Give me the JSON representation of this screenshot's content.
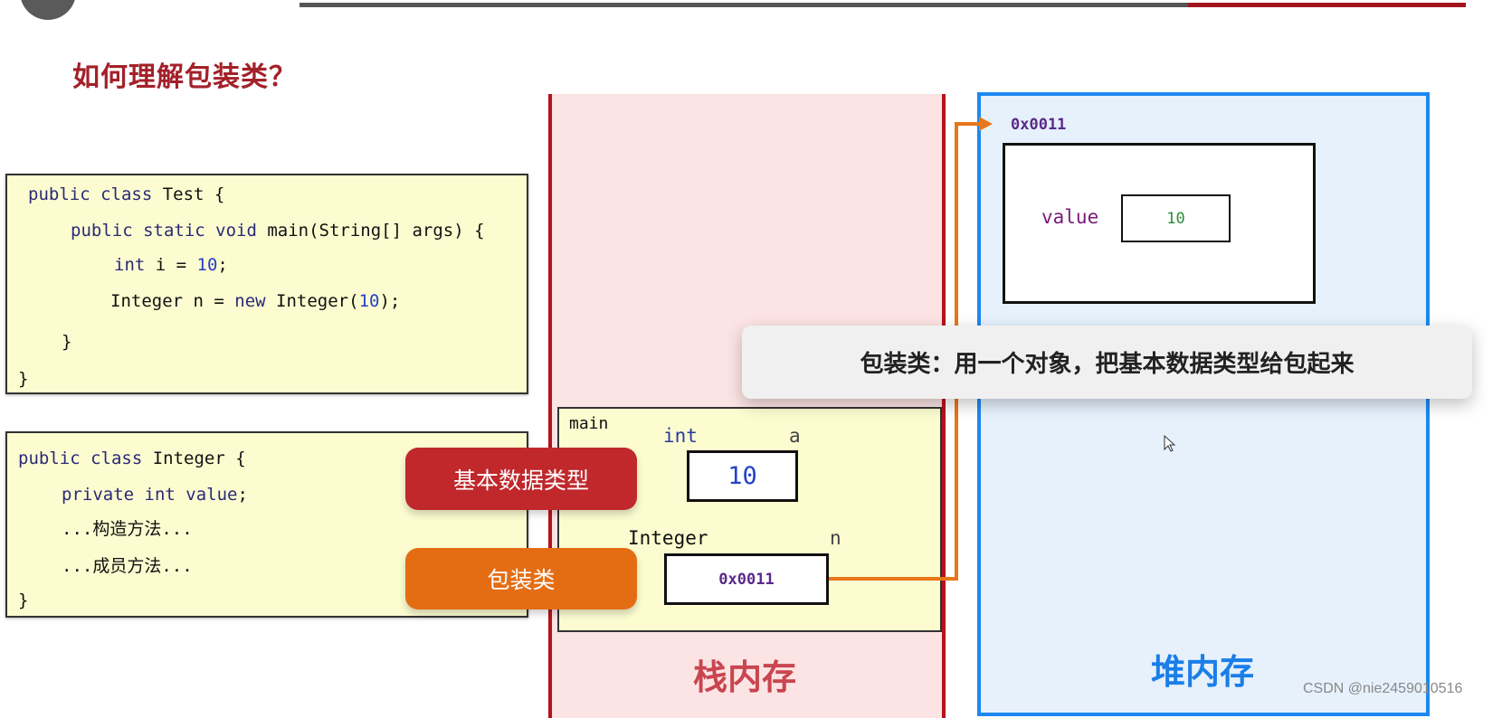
{
  "title": "如何理解包装类？",
  "colors": {
    "title": "#a3212a",
    "stack_border": "#b5121b",
    "stack_fill": "#fde4e4",
    "heap_border": "#1e88f0",
    "heap_fill": "#e6f1fc",
    "arrow": "#e8761a",
    "pill_primitive": "#c0282c",
    "pill_wrapper": "#e46d14"
  },
  "code_test": {
    "l1": [
      "public class",
      " Test {"
    ],
    "l2": [
      "public static void",
      " main(String[] args) {"
    ],
    "l3": [
      "int",
      " i = ",
      "10",
      ";"
    ],
    "l4": [
      "Integer n = ",
      "new",
      " Integer(",
      "10",
      ");"
    ],
    "l5": "}",
    "l6": "}"
  },
  "code_integer": {
    "l1": [
      "public class",
      " Integer {"
    ],
    "l2": [
      "private int value",
      ";"
    ],
    "l3": "...构造方法...",
    "l4": "...成员方法...",
    "l5": "}"
  },
  "stack": {
    "label": "栈内存",
    "frame_name": "main",
    "var_a": {
      "type": "int",
      "name": "a",
      "value": "10"
    },
    "var_n": {
      "type": "Integer",
      "name": "n",
      "value": "0x0011"
    }
  },
  "heap": {
    "label": "堆内存",
    "address": "0x0011",
    "field_name": "value",
    "field_value": "10"
  },
  "pills": {
    "primitive": "基本数据类型",
    "wrapper": "包装类"
  },
  "banner": "包装类：用一个对象，把基本数据类型给包起来",
  "watermark": "CSDN @nie2459010516"
}
